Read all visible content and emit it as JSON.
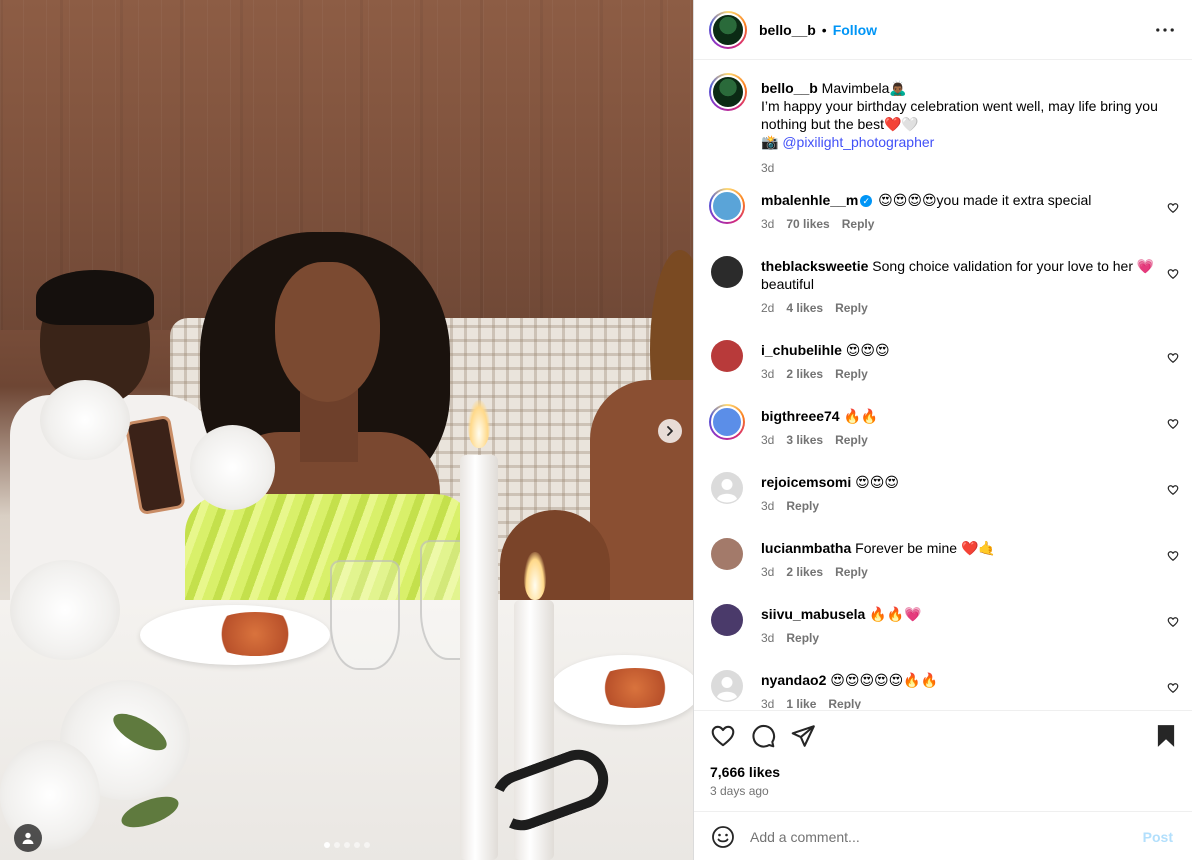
{
  "post": {
    "username": "bello__b",
    "follow_label": "Follow",
    "separator": "•",
    "caption": {
      "username": "bello__b",
      "text_line1": " Mavimbela🙇🏾‍♂️",
      "text_line2": "I’m happy your birthday celebration went well, may life bring you nothing but the best❤️🤍",
      "camera": "📸 ",
      "mention": "@pixilight_photographer",
      "time": "3d"
    },
    "likes": "7,666 likes",
    "date": "3 days ago"
  },
  "comments": [
    {
      "username": "mbalenhle__m",
      "verified": true,
      "text": " 😍😍😍😍you made it extra special",
      "time": "3d",
      "likes": "70 likes",
      "reply": "Reply",
      "avatar_color": "#5aa4d8"
    },
    {
      "username": "theblacksweetie",
      "verified": false,
      "text": " Song choice validation for your love to her 💗 beautiful",
      "time": "2d",
      "likes": "4 likes",
      "reply": "Reply",
      "avatar_color": "#2b2b2b"
    },
    {
      "username": "i_chubelihle",
      "verified": false,
      "text": " 😍😍😍",
      "time": "3d",
      "likes": "2 likes",
      "reply": "Reply",
      "avatar_color": "#b83a3a"
    },
    {
      "username": "bigthreee74",
      "verified": false,
      "text": " 🔥🔥",
      "time": "3d",
      "likes": "3 likes",
      "reply": "Reply",
      "avatar_color": "#5b8ee8"
    },
    {
      "username": "rejoicemsomi",
      "verified": false,
      "text": " 😍😍😍",
      "time": "3d",
      "likes": "",
      "reply": "Reply",
      "avatar_color": "#dbdbdb"
    },
    {
      "username": "lucianmbatha",
      "verified": false,
      "text": " Forever be mine ❤️🤙",
      "time": "3d",
      "likes": "2 likes",
      "reply": "Reply",
      "avatar_color": "#a37a6a"
    },
    {
      "username": "siivu_mabusela",
      "verified": false,
      "text": " 🔥🔥💗",
      "time": "3d",
      "likes": "",
      "reply": "Reply",
      "avatar_color": "#4a3a6a"
    },
    {
      "username": "nyandao2",
      "verified": false,
      "text": " 😍😍😍😍😍🔥🔥",
      "time": "3d",
      "likes": "1 like",
      "reply": "Reply",
      "avatar_color": "#dbdbdb"
    }
  ],
  "add_comment": {
    "placeholder": "Add a comment...",
    "post_label": "Post"
  },
  "icons": {
    "more": "more-options-icon",
    "like": "heart-icon",
    "comment": "comment-icon",
    "share": "share-icon",
    "save": "bookmark-icon",
    "emoji": "emoji-icon",
    "next": "chevron-right-icon",
    "tag": "user-tag-icon"
  },
  "carousel": {
    "count": 5,
    "active": 0
  },
  "colors": {
    "accent": "#0095f6",
    "mention": "#4150f7",
    "muted": "#737373",
    "post_disabled": "#b2dffc"
  }
}
